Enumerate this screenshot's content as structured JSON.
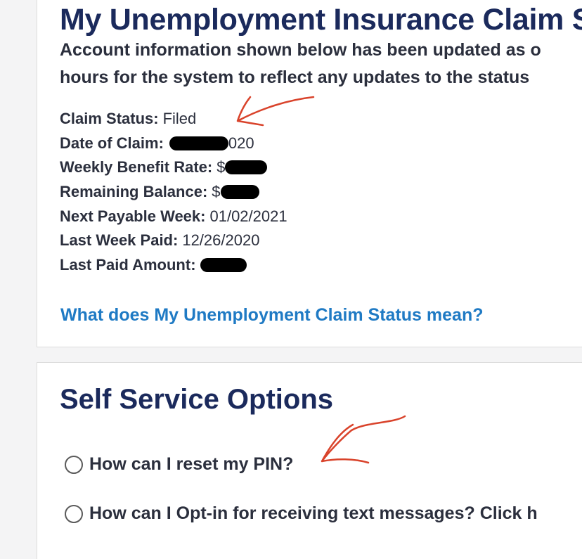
{
  "header": {
    "title": "My Unemployment Insurance Claim S",
    "notice_line1": "Account information shown below has been updated as o",
    "notice_line2": "hours for the system to reflect any updates to the status"
  },
  "claim": {
    "rows": [
      {
        "label": "Claim Status:",
        "value": "Filed"
      },
      {
        "label": "Date of Claim:",
        "value": "020"
      },
      {
        "label": "Weekly Benefit Rate:",
        "value": "$"
      },
      {
        "label": "Remaining Balance:",
        "value": "$"
      },
      {
        "label": "Next Payable Week:",
        "value": "01/02/2021"
      },
      {
        "label": "Last Week Paid:",
        "value": "12/26/2020"
      },
      {
        "label": "Last Paid Amount:",
        "value": ""
      }
    ],
    "help_link": "What does My Unemployment Claim Status mean?"
  },
  "self_service": {
    "title": "Self Service Options",
    "options": [
      {
        "label": "How can I reset my PIN?",
        "checked": false
      },
      {
        "label": "How can I Opt-in for receiving text messages? Click h",
        "checked": false
      }
    ]
  },
  "colors": {
    "title": "#1b2a5c",
    "link": "#1f7ac4",
    "annotation": "#d9432b",
    "redaction": "#000000"
  }
}
